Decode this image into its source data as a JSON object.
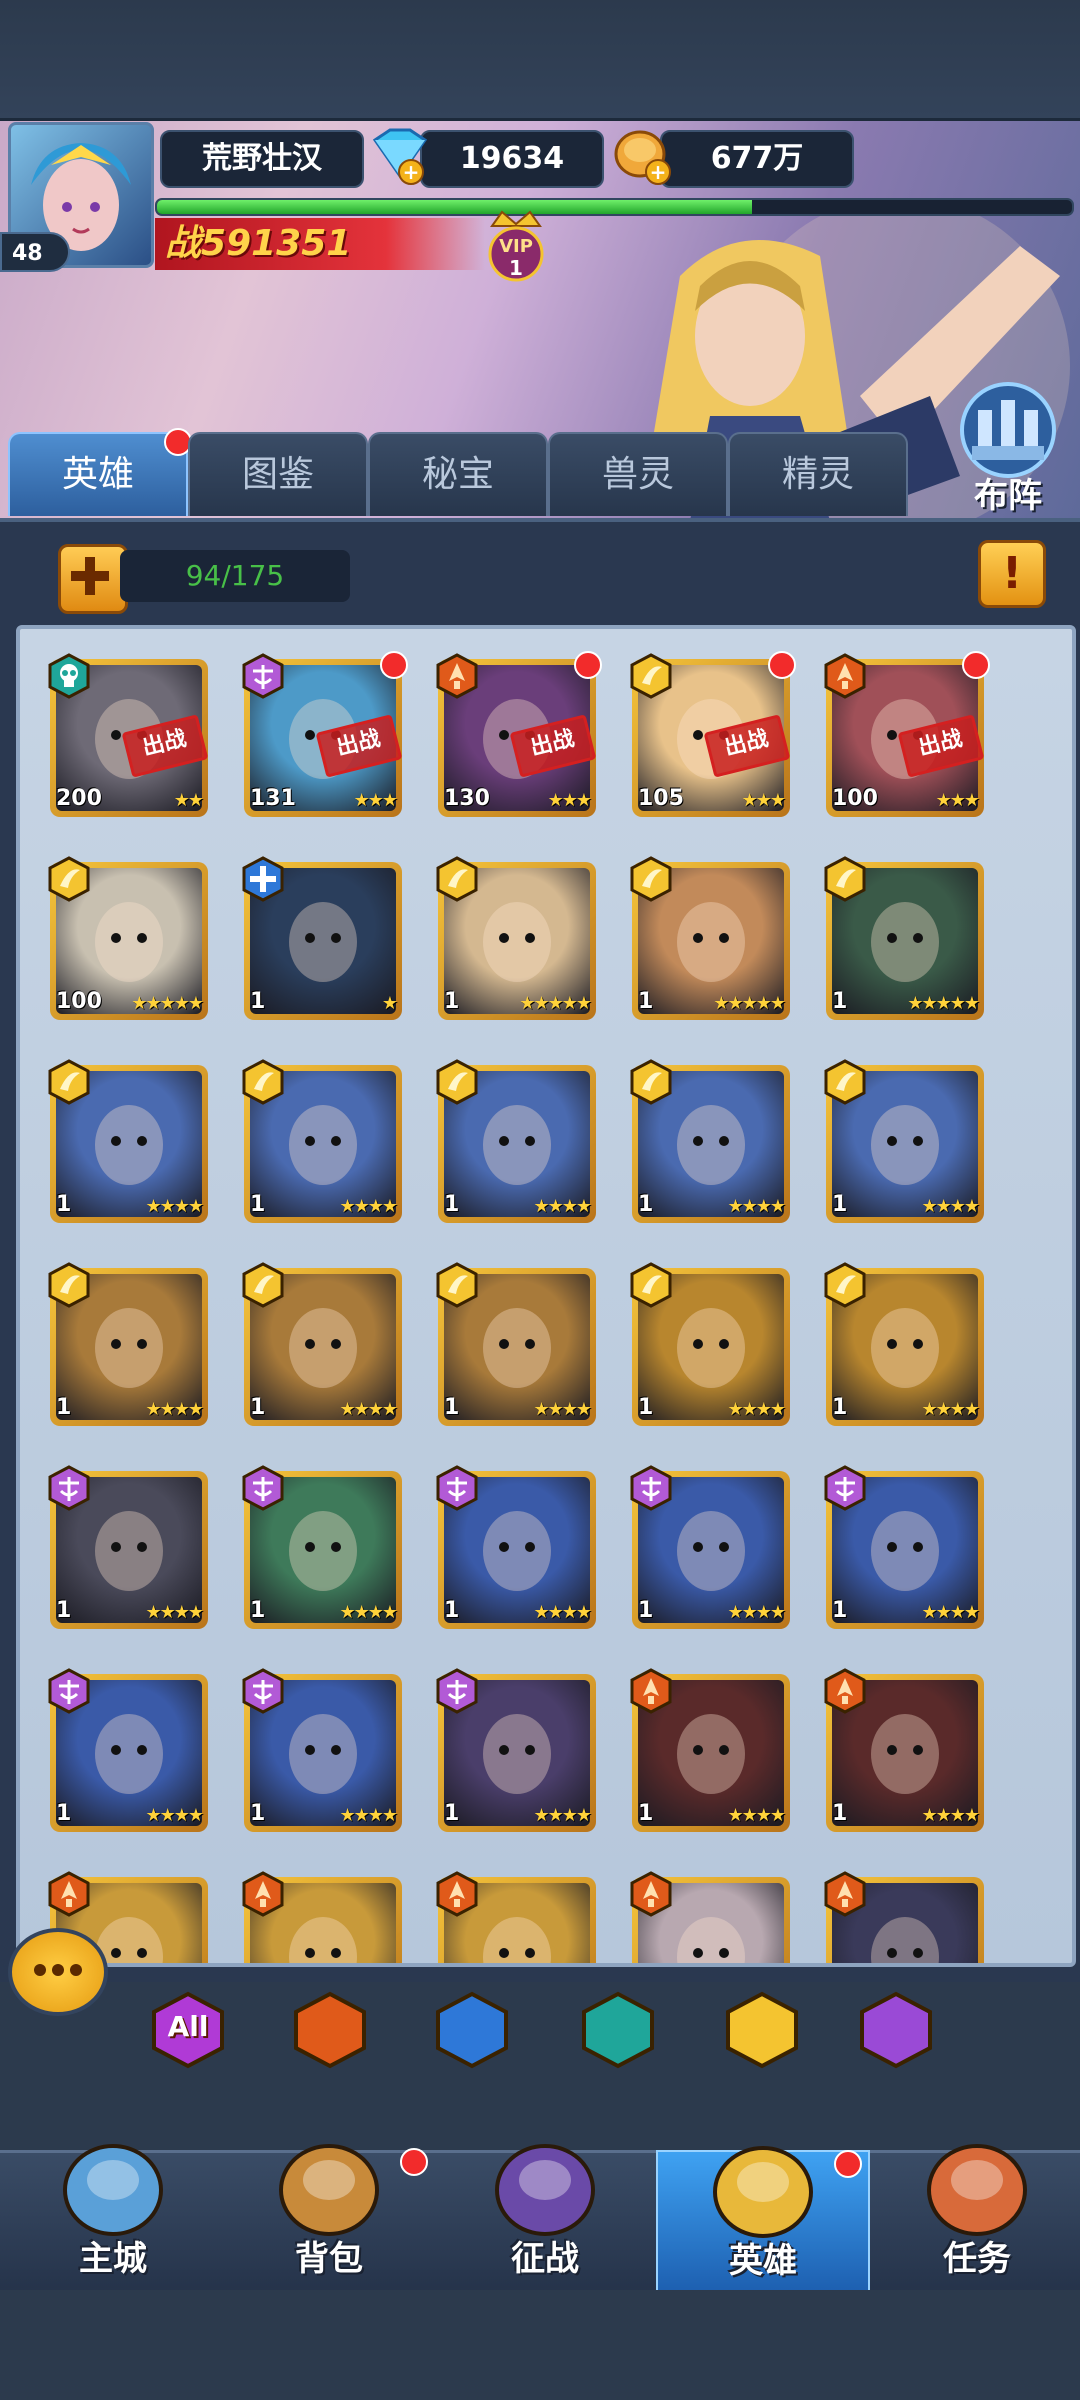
{
  "player": {
    "name": "荒野壮汉",
    "level": "48",
    "diamonds": "19634",
    "gold": "677万",
    "power_label": "战",
    "power": "591351",
    "vip_label": "VIP",
    "vip_level": "1",
    "xp_fraction": 0.65
  },
  "tabs": [
    {
      "label": "英雄",
      "active": true,
      "badge": true
    },
    {
      "label": "图鉴"
    },
    {
      "label": "秘宝"
    },
    {
      "label": "兽灵"
    },
    {
      "label": "精灵"
    }
  ],
  "formation_label": "布阵",
  "hero_capacity": "94/175",
  "deployed_stamp": "出战",
  "colors": {
    "light": "#f4c430",
    "dark": "#b25ad6",
    "fire": "#e05a1a",
    "water": "#2e78d8",
    "death": "#1fa69a"
  },
  "heroes": [
    {
      "level": "200",
      "faction": "death",
      "stars": "★★",
      "deployed": true,
      "dot": false,
      "face": "#6e6a76"
    },
    {
      "level": "131",
      "faction": "dark",
      "stars": "★★★",
      "deployed": true,
      "dot": true,
      "face": "#4d9ac8"
    },
    {
      "level": "130",
      "faction": "fire",
      "stars": "★★★",
      "deployed": true,
      "dot": true,
      "face": "#6a3e7a"
    },
    {
      "level": "105",
      "faction": "light",
      "stars": "★★★",
      "deployed": true,
      "dot": true,
      "face": "#e8c28a"
    },
    {
      "level": "100",
      "faction": "fire",
      "stars": "★★★",
      "deployed": true,
      "dot": true,
      "face": "#a05058"
    },
    {
      "level": "100",
      "faction": "light",
      "stars": "★★★★★",
      "deployed": false,
      "dot": false,
      "face": "#c8c0b0"
    },
    {
      "level": "1",
      "faction": "water",
      "stars": "★",
      "deployed": false,
      "dot": false,
      "face": "#2a3e5c"
    },
    {
      "level": "1",
      "faction": "light",
      "stars": "★★★★★",
      "deployed": false,
      "dot": false,
      "face": "#d4b890"
    },
    {
      "level": "1",
      "faction": "light",
      "stars": "★★★★★",
      "deployed": false,
      "dot": false,
      "face": "#c28a5a"
    },
    {
      "level": "1",
      "faction": "light",
      "stars": "★★★★★",
      "deployed": false,
      "dot": false,
      "face": "#3a5a48"
    },
    {
      "level": "1",
      "faction": "light",
      "stars": "★★★★",
      "deployed": false,
      "dot": false,
      "face": "#4a6ab0"
    },
    {
      "level": "1",
      "faction": "light",
      "stars": "★★★★",
      "deployed": false,
      "dot": false,
      "face": "#4a6ab0"
    },
    {
      "level": "1",
      "faction": "light",
      "stars": "★★★★",
      "deployed": false,
      "dot": false,
      "face": "#4a6ab0"
    },
    {
      "level": "1",
      "faction": "light",
      "stars": "★★★★",
      "deployed": false,
      "dot": false,
      "face": "#4a6ab0"
    },
    {
      "level": "1",
      "faction": "light",
      "stars": "★★★★",
      "deployed": false,
      "dot": false,
      "face": "#4a6ab0"
    },
    {
      "level": "1",
      "faction": "light",
      "stars": "★★★★",
      "deployed": false,
      "dot": false,
      "face": "#a87a3a"
    },
    {
      "level": "1",
      "faction": "light",
      "stars": "★★★★",
      "deployed": false,
      "dot": false,
      "face": "#a87a3a"
    },
    {
      "level": "1",
      "faction": "light",
      "stars": "★★★★",
      "deployed": false,
      "dot": false,
      "face": "#a87a3a"
    },
    {
      "level": "1",
      "faction": "light",
      "stars": "★★★★",
      "deployed": false,
      "dot": false,
      "face": "#b8862e"
    },
    {
      "level": "1",
      "faction": "light",
      "stars": "★★★★",
      "deployed": false,
      "dot": false,
      "face": "#b8862e"
    },
    {
      "level": "1",
      "faction": "dark",
      "stars": "★★★★",
      "deployed": false,
      "dot": false,
      "face": "#4a4a5a"
    },
    {
      "level": "1",
      "faction": "dark",
      "stars": "★★★★",
      "deployed": false,
      "dot": false,
      "face": "#3e7a5a"
    },
    {
      "level": "1",
      "faction": "dark",
      "stars": "★★★★",
      "deployed": false,
      "dot": false,
      "face": "#3a5aa8"
    },
    {
      "level": "1",
      "faction": "dark",
      "stars": "★★★★",
      "deployed": false,
      "dot": false,
      "face": "#3a5aa8"
    },
    {
      "level": "1",
      "faction": "dark",
      "stars": "★★★★",
      "deployed": false,
      "dot": false,
      "face": "#3a5aa8"
    },
    {
      "level": "1",
      "faction": "dark",
      "stars": "★★★★",
      "deployed": false,
      "dot": false,
      "face": "#3a5aa8"
    },
    {
      "level": "1",
      "faction": "dark",
      "stars": "★★★★",
      "deployed": false,
      "dot": false,
      "face": "#3a5aa8"
    },
    {
      "level": "1",
      "faction": "dark",
      "stars": "★★★★",
      "deployed": false,
      "dot": false,
      "face": "#4a3e6a"
    },
    {
      "level": "1",
      "faction": "fire",
      "stars": "★★★★",
      "deployed": false,
      "dot": false,
      "face": "#5a2a2a"
    },
    {
      "level": "1",
      "faction": "fire",
      "stars": "★★★★",
      "deployed": false,
      "dot": false,
      "face": "#5a2a2a"
    },
    {
      "level": "",
      "faction": "fire",
      "stars": "",
      "deployed": false,
      "dot": false,
      "face": "#c89a3a"
    },
    {
      "level": "",
      "faction": "fire",
      "stars": "",
      "deployed": false,
      "dot": false,
      "face": "#c89a3a"
    },
    {
      "level": "",
      "faction": "fire",
      "stars": "",
      "deployed": false,
      "dot": false,
      "face": "#c89a3a"
    },
    {
      "level": "",
      "faction": "fire",
      "stars": "",
      "deployed": false,
      "dot": false,
      "face": "#b8a8b0"
    },
    {
      "level": "",
      "faction": "fire",
      "stars": "",
      "deployed": false,
      "dot": false,
      "face": "#3a3a5a"
    }
  ],
  "filters": [
    {
      "label": "All",
      "icon": "all-icon",
      "color": "#b03ad6"
    },
    {
      "label": "",
      "icon": "fire-faction-icon",
      "color": "#e05a1a"
    },
    {
      "label": "",
      "icon": "water-faction-icon",
      "color": "#2e78d8"
    },
    {
      "label": "",
      "icon": "death-faction-icon",
      "color": "#1fa69a"
    },
    {
      "label": "",
      "icon": "light-faction-icon",
      "color": "#f4c430"
    },
    {
      "label": "",
      "icon": "dark-faction-icon",
      "color": "#9a4ad6"
    }
  ],
  "nav": [
    {
      "label": "主城",
      "icon": "castle-icon",
      "active": false,
      "badge": false
    },
    {
      "label": "背包",
      "icon": "chest-icon",
      "active": false,
      "badge": true
    },
    {
      "label": "征战",
      "icon": "portal-icon",
      "active": false,
      "badge": false
    },
    {
      "label": "英雄",
      "icon": "helmet-icon",
      "active": true,
      "badge": true
    },
    {
      "label": "任务",
      "icon": "scroll-icon",
      "active": false,
      "badge": false
    }
  ]
}
